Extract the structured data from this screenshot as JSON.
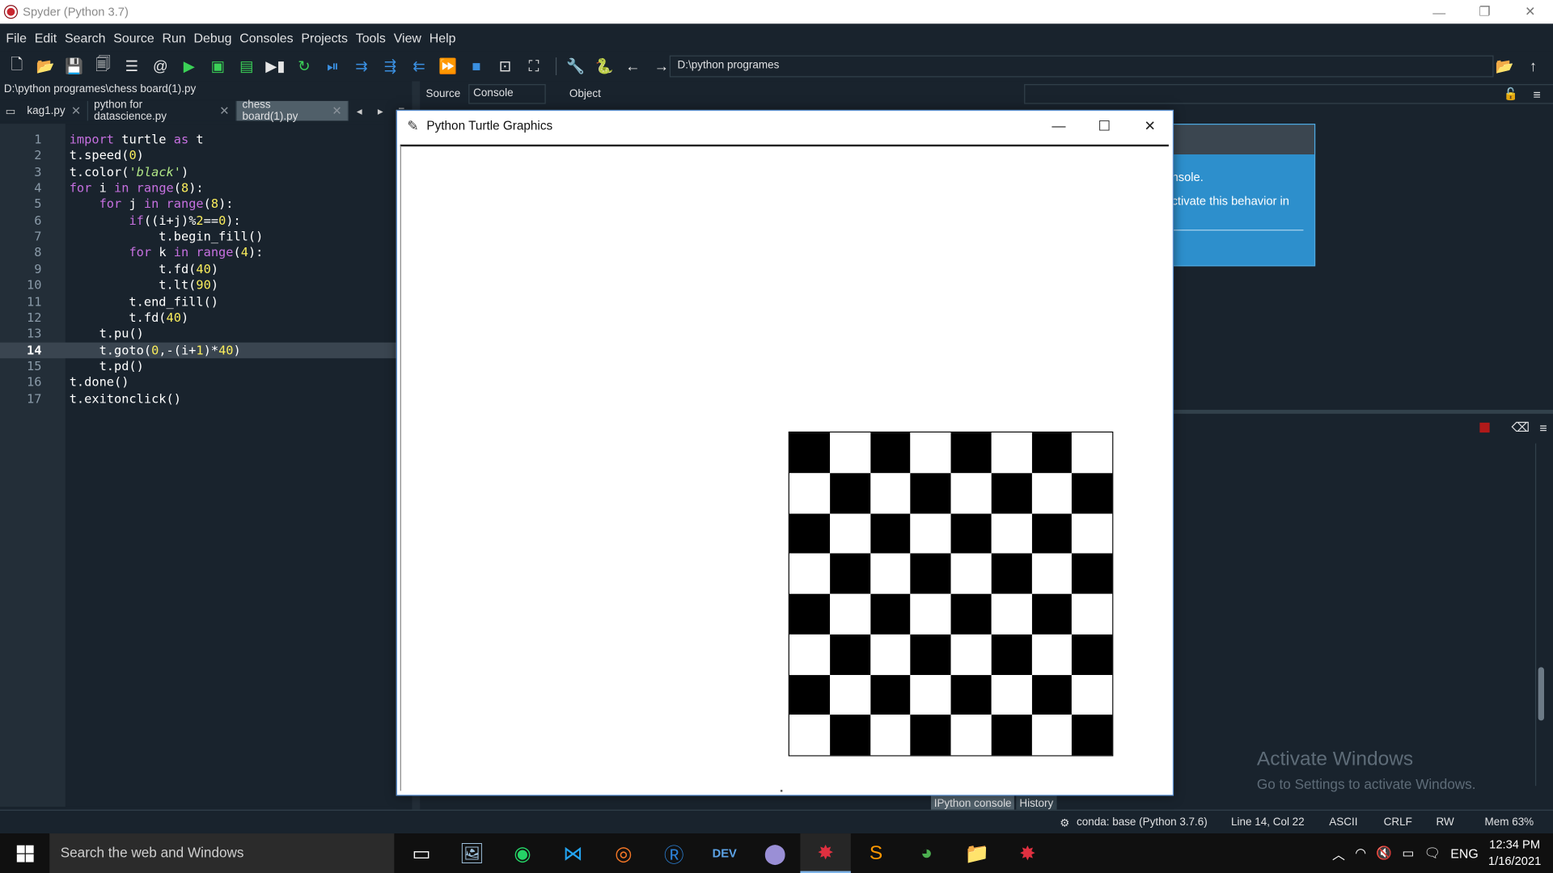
{
  "window": {
    "title": "Spyder (Python 3.7)",
    "minimize": "—",
    "restore": "❐",
    "close": "✕"
  },
  "menu": [
    "File",
    "Edit",
    "Search",
    "Source",
    "Run",
    "Debug",
    "Consoles",
    "Projects",
    "Tools",
    "View",
    "Help"
  ],
  "toolbar": {
    "path": "D:\\python programes"
  },
  "editor": {
    "file_path": "D:\\python programes\\chess board(1).py",
    "tabs": [
      {
        "label": "kag1.py",
        "active": false
      },
      {
        "label": "python for datascience.py",
        "active": false
      },
      {
        "label": "chess board(1).py",
        "active": true
      }
    ],
    "current_line": 14,
    "lines": [
      "import turtle as t",
      "t.speed(0)",
      "t.color('black')",
      "for i in range(8):",
      "    for j in range(8):",
      "        if((i+j)%2==0):",
      "            t.begin_fill()",
      "        for k in range(4):",
      "            t.fd(40)",
      "            t.lt(90)",
      "        t.end_fill()",
      "        t.fd(40)",
      "    t.pu()",
      "    t.goto(0,-(i+1)*40)",
      "    t.pd()",
      "t.done()",
      "t.exitonclick()"
    ]
  },
  "right_pane": {
    "source_label": "Source",
    "console_value": "Console",
    "object_label": "Object",
    "balloon_line1": "nsole.",
    "balloon_line2": "ctivate this behavior in",
    "bottom_tabs": [
      "IPython console",
      "History"
    ]
  },
  "turtle_window": {
    "title": "Python Turtle Graphics",
    "board": {
      "rows": 8,
      "cols": 8,
      "first_square": "black"
    }
  },
  "watermark": {
    "line1": "Activate Windows",
    "line2": "Go to Settings to activate Windows."
  },
  "statusbar": {
    "env": "conda: base (Python 3.7.6)",
    "position": "Line 14, Col 22",
    "encoding": "ASCII",
    "eol": "CRLF",
    "permissions": "RW",
    "memory": "Mem 63%"
  },
  "taskbar": {
    "search_placeholder": "Search the web and Windows",
    "language": "ENG",
    "time": "12:34 PM",
    "date": "1/16/2021"
  }
}
